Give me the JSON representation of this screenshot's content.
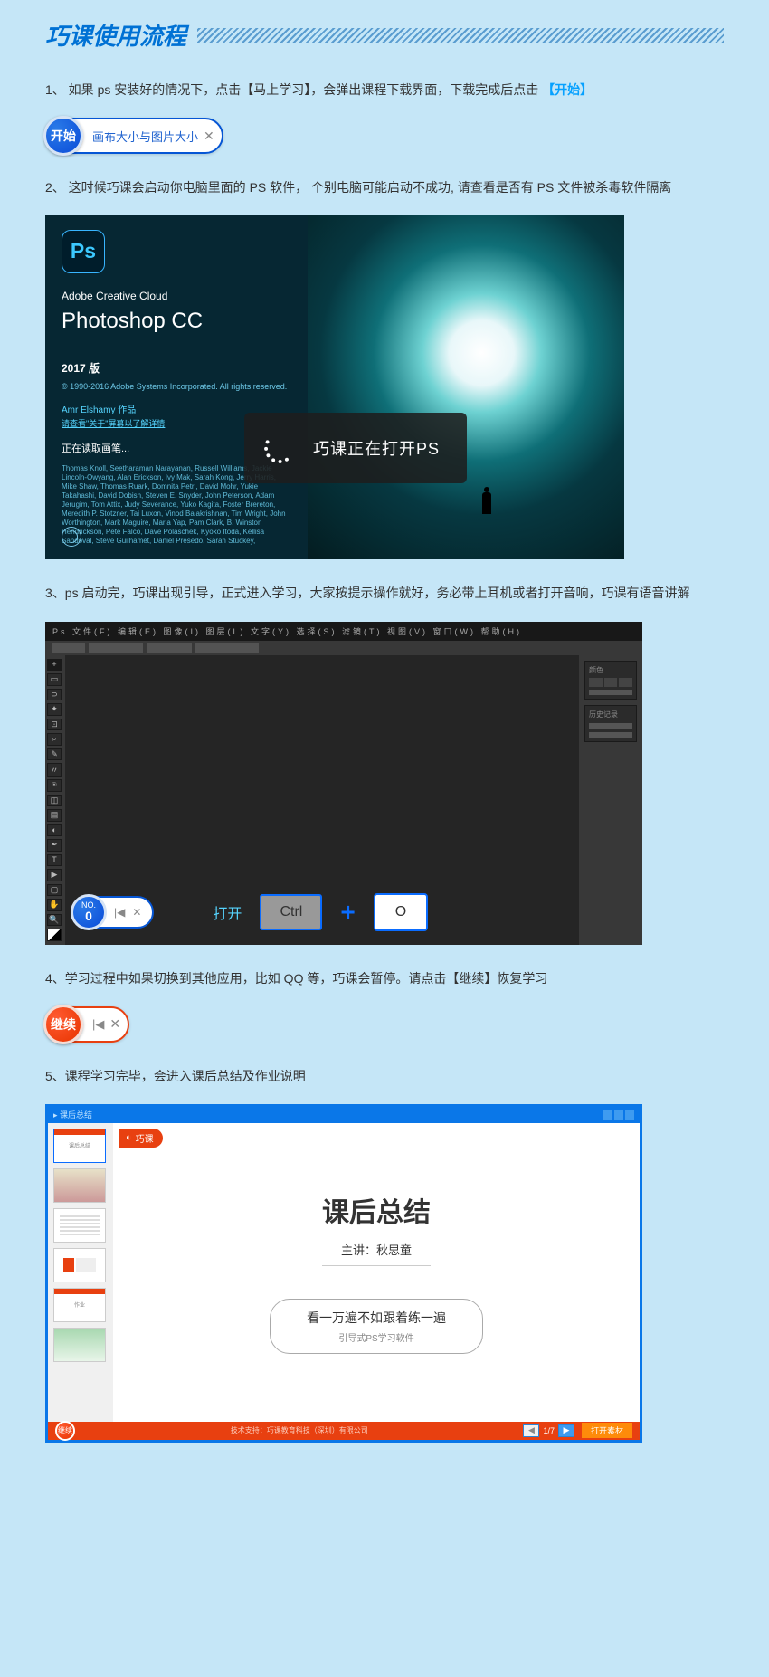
{
  "header": {
    "title": "巧课使用流程"
  },
  "steps": {
    "s1": "1、 如果 ps 安装好的情况下，点击【马上学习】，会弹出课程下载界面，下载完成后点击",
    "s1_link": "【开始】",
    "s2": "2、 这时候巧课会启动你电脑里面的 PS 软件， 个别电脑可能启动不成功, 请查看是否有 PS 文件被杀毒软件隔离",
    "s3": "3、ps 启动完，巧课出现引导，正式进入学习，大家按提示操作就好，务必带上耳机或者打开音响，巧课有语音讲解",
    "s4": "4、学习过程中如果切换到其他应用，比如 QQ 等，巧课会暂停。请点击【继续】恢复学习",
    "s5": "5、课程学习完毕，会进入课后总结及作业说明"
  },
  "pill1": {
    "btn": "开始",
    "text": "画布大小与图片大小",
    "close": "✕"
  },
  "splash": {
    "logo": "Ps",
    "sub": "Adobe Creative Cloud",
    "name": "Photoshop CC",
    "ver": "2017 版",
    "copy": "© 1990-2016 Adobe Systems Incorporated.\nAll rights reserved.",
    "author": "Amr Elshamy 作品",
    "link": "请查看\"关于\"屏幕以了解详情",
    "reading": "正在读取画笔...",
    "credits": "Thomas Knoll, Seetharaman Narayanan, Russell Williams, Jackie Lincoln-Owyang, Alan Erickson, Ivy Mak, Sarah Kong, Jerry Harris, Mike Shaw, Thomas Ruark, Domnita Petri, David Mohr, Yukie Takahashi, David Dobish, Steven E. Snyder, John Peterson, Adam Jerugim, Tom Attix, Judy Severance, Yuko Kagita, Foster Brereton, Meredith P. Stotzner, Tai Luxon, Vinod Balakrishnan, Tim Wright, John Worthington, Mark Maguire, Maria Yap, Pam Clark, B. Winston Hendrickson, Pete Falco, Dave Polaschek, Kyoko Itoda, Kellisa Sandoval, Steve Guilhamet, Daniel Presedo, Sarah Stuckey,",
    "overlay": "巧课正在打开PS"
  },
  "psui": {
    "menu": "Ps 文件(F) 编辑(E) 图像(I) 图层(L) 文字(Y) 选择(S) 滤镜(T) 视图(V) 窗口(W) 帮助(H)",
    "panel1": "颜色",
    "panel2": "历史记录",
    "no_label": "NO.",
    "no_num": "0",
    "prev": "|◀",
    "close": "✕",
    "open": "打开",
    "key_ctrl": "Ctrl",
    "plus": "+",
    "key_o": "O"
  },
  "pill2": {
    "btn": "继续",
    "prev": "|◀",
    "close": "✕"
  },
  "summary": {
    "wintitle": "课后总结",
    "logo": "巧课",
    "title": "课后总结",
    "speaker": "主讲：秋思童",
    "motto1": "看一万遍不如跟着练一遍",
    "motto2": "引导式PS学习软件",
    "thumbs": {
      "t1": "课后总结",
      "t5": "作业"
    },
    "footer_cont": "继续",
    "footer_page": "1/7",
    "footer_center": "技术支持：巧课教育科技（深圳）有限公司",
    "footer_btn": "打开素材"
  }
}
